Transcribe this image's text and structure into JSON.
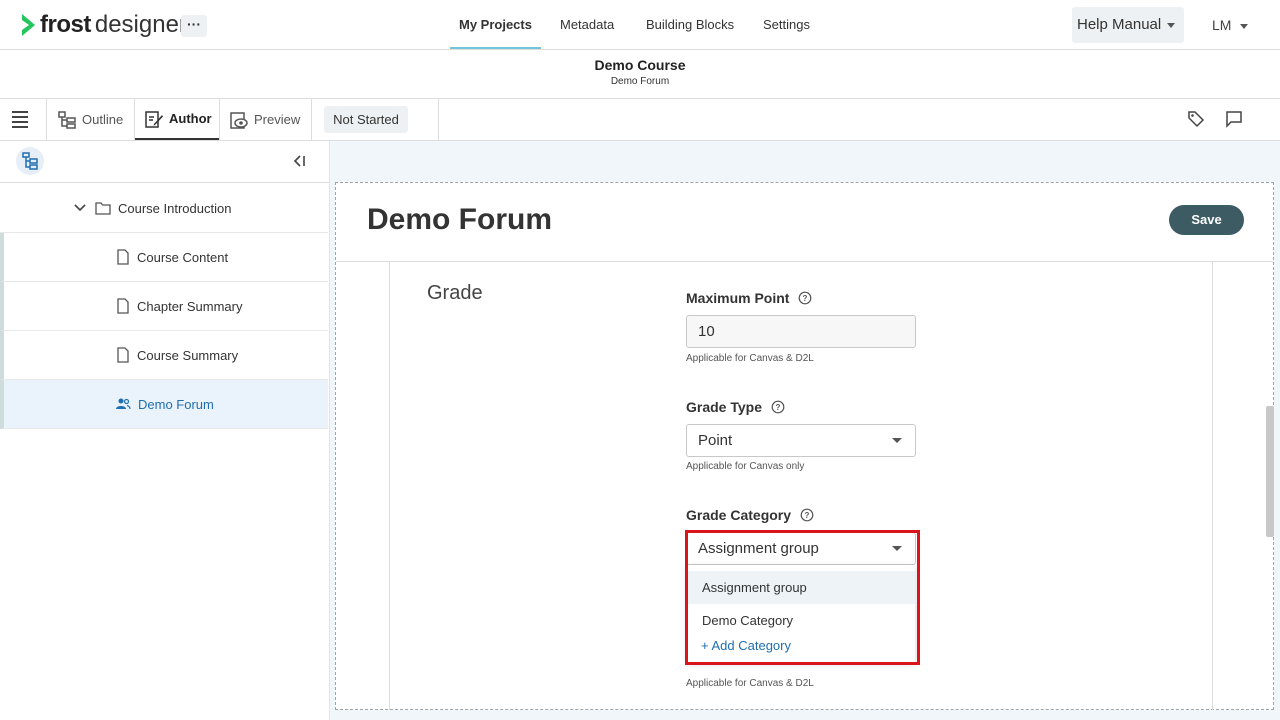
{
  "app": {
    "logo_bold": "frost",
    "logo_rest": "designer",
    "more_label": "···",
    "brand_color": "#22c55e"
  },
  "nav": {
    "items": [
      "My Projects",
      "Metadata",
      "Building Blocks",
      "Settings"
    ],
    "active": "My Projects",
    "help_label": "Help Manual",
    "user_initials": "LM"
  },
  "course": {
    "title": "Demo Course",
    "subtitle": "Demo Forum"
  },
  "toolbar": {
    "tabs": [
      "Outline",
      "Author",
      "Preview"
    ],
    "active_tab": "Author",
    "status": "Not Started"
  },
  "tree": {
    "folder": "Course Introduction",
    "items": [
      {
        "label": "Course Content",
        "icon": "page-icon"
      },
      {
        "label": "Chapter Summary",
        "icon": "page-icon"
      },
      {
        "label": "Course Summary",
        "icon": "page-icon"
      },
      {
        "label": "Demo Forum",
        "icon": "users-icon",
        "selected": true
      }
    ]
  },
  "editor": {
    "title": "Demo Forum",
    "save_label": "Save",
    "section": "Grade",
    "max_point_label": "Maximum Point",
    "max_point_value": "10",
    "max_point_hint": "Applicable for Canvas & D2L",
    "grade_type_label": "Grade Type",
    "grade_type_value": "Point",
    "grade_type_hint": "Applicable for Canvas only",
    "grade_category_label": "Grade Category",
    "grade_category_value": "Assignment group",
    "grade_category_hint": "Applicable for Canvas & D2L",
    "dropdown_options": [
      "Assignment group",
      "Demo Category"
    ],
    "add_category_label": "+ Add Category"
  },
  "colors": {
    "save_button": "#3c5b63",
    "highlight": "#d9141b",
    "accent_link": "#1f6fb0"
  }
}
